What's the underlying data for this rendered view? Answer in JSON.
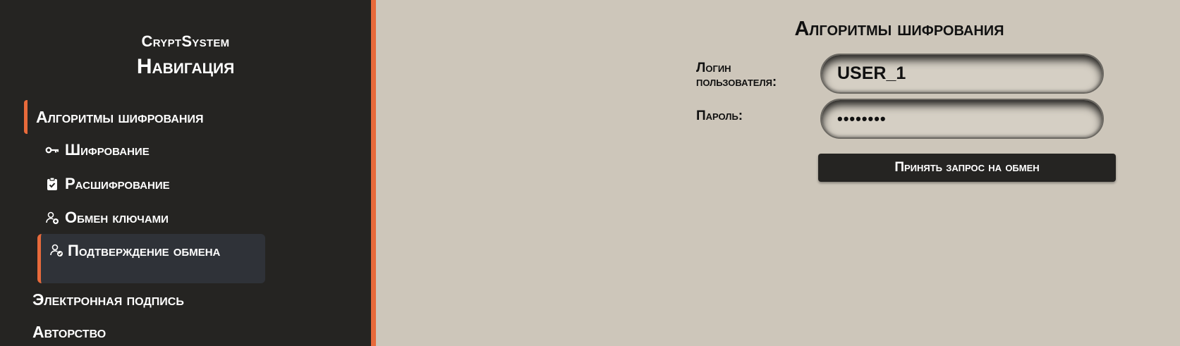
{
  "sidebar": {
    "brand": "CryptSystem",
    "title": "Навигация",
    "section_encryption": "Алгоритмы шифрования",
    "items": [
      {
        "label": "Шифрование",
        "icon": "key-icon"
      },
      {
        "label": "Расшифрование",
        "icon": "clipboard-check-icon"
      },
      {
        "label": "Обмен ключами",
        "icon": "user-add-icon"
      },
      {
        "label": "Подтверждение обмена",
        "icon": "user-check-icon"
      }
    ],
    "section_signature": "Электронная подпись",
    "section_authorship": "Авторство"
  },
  "main": {
    "title": "Алгоритмы шифрования",
    "login_label": "Логин пользователя:",
    "login_value": "USER_1",
    "password_label": "Пароль:",
    "password_value": "••••••••",
    "submit_label": "Принять запрос на обмен"
  },
  "colors": {
    "sidebar_bg": "#252422",
    "accent": "#e86a3b",
    "page_bg": "#cdc6ba",
    "active_item_bg": "#2f3238"
  }
}
